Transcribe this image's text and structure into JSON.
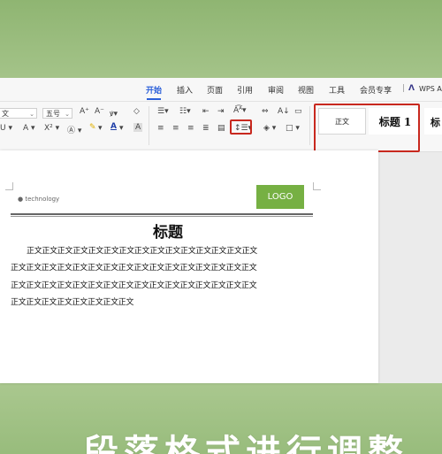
{
  "menubar": {
    "tabs": [
      "开始",
      "插入",
      "页面",
      "引用",
      "审阅",
      "视图",
      "工具",
      "会员专享"
    ],
    "active_tab": "开始",
    "app_label": "WPS A"
  },
  "toolbar": {
    "font_name": "文",
    "font_size": "五号",
    "styles": {
      "normal_label": "正文",
      "heading1_label": "标题 1",
      "heading_partial_label": "标"
    }
  },
  "document": {
    "logo_text": "LOGO",
    "tagline": "● technology",
    "title": "标题",
    "lines": [
      "正文正文正文正文正文正文正文正文正文正文正文正文正文正文正文",
      "正文正文正文正文正文正文正文正文正文正文正文正文正文正文正文正文",
      "正文正文正文正文正文正文正文正文正文正文正文正文正文正文正文正文",
      "正文正文正文正文正文正文正文正文"
    ]
  },
  "caption": "、段落格式进行调整",
  "colors": {
    "accent": "#2b5fd9",
    "highlight_box": "#c8281e",
    "logo_green": "#76b043"
  }
}
